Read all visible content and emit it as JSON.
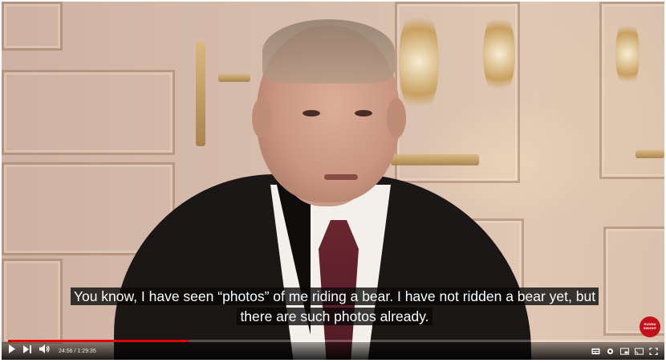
{
  "subtitle": {
    "line1": "You know, I have seen “photos” of me riding a bear. I have not ridden a bear yet, but",
    "line2": "there are such photos already."
  },
  "watermark": {
    "text": "RUSSIA INSIGHT",
    "color": "#c1121c"
  },
  "player": {
    "time_current": "24:56",
    "time_total": "1:29:35",
    "time_display": "24:56 / 1:29:35",
    "progress_fraction": 0.278,
    "progress_color": "#e00000",
    "icons": {
      "play": "play-icon",
      "next": "next-icon",
      "volume": "volume-icon",
      "subtitles": "subtitles-icon",
      "settings": "settings-icon",
      "miniplayer": "miniplayer-icon",
      "cast": "cast-icon",
      "fullscreen": "fullscreen-icon"
    }
  }
}
